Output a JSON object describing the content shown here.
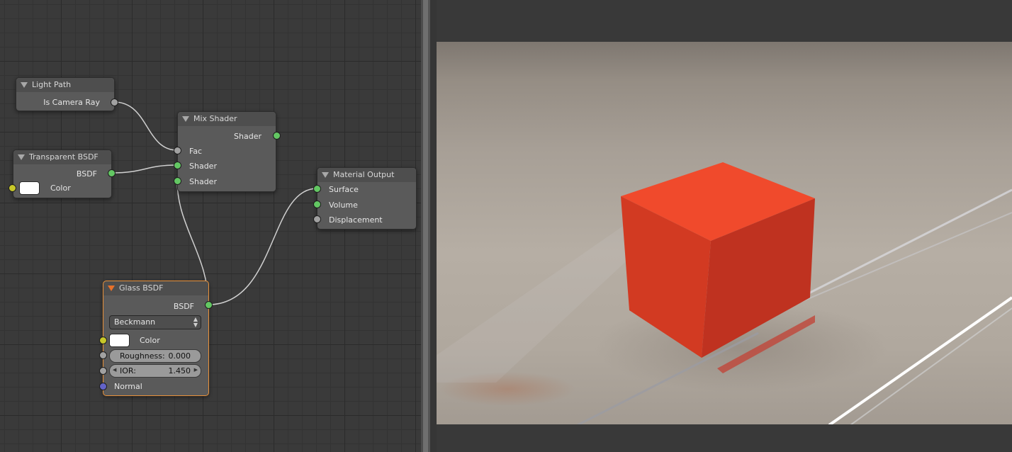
{
  "nodes": {
    "light_path": {
      "title": "Light Path",
      "outputs": [
        "Is Camera Ray"
      ]
    },
    "transparent_bsdf": {
      "title": "Transparent BSDF",
      "output": "BSDF",
      "color_label": "Color"
    },
    "mix_shader": {
      "title": "Mix Shader",
      "output": "Shader",
      "inputs": [
        "Fac",
        "Shader",
        "Shader"
      ]
    },
    "material_output": {
      "title": "Material Output",
      "inputs": [
        "Surface",
        "Volume",
        "Displacement"
      ]
    },
    "glass_bsdf": {
      "title": "Glass BSDF",
      "output": "BSDF",
      "distribution": "Beckmann",
      "color_label": "Color",
      "roughness_label": "Roughness:",
      "roughness_value": "0.000",
      "ior_label": "IOR:",
      "ior_value": "1.450",
      "normal_label": "Normal"
    }
  },
  "colors": {
    "socket_shader": "#63c763",
    "socket_color": "#c7c729",
    "socket_float": "#a1a1a1",
    "socket_vector": "#6363c7",
    "selected_outline": "#e8913a",
    "cube": "#e24a2c"
  }
}
